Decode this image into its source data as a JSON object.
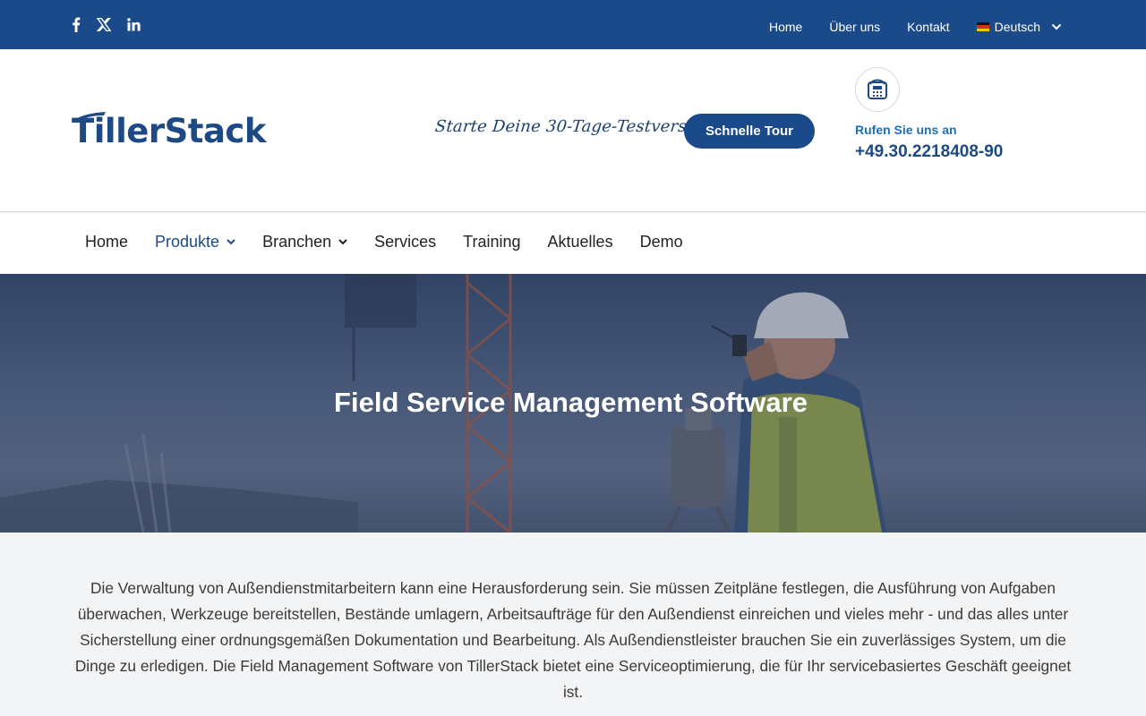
{
  "topbar": {
    "social": [
      "facebook-icon",
      "x-icon",
      "linkedin-icon"
    ],
    "links": [
      "Home",
      "Über uns",
      "Kontakt"
    ],
    "language": "Deutsch"
  },
  "header": {
    "logo_text": "TillerStack",
    "tagline": "Starte Deine 30-Tage-Testversion",
    "tour_button": "Schnelle Tour",
    "call_label": "Rufen Sie uns an",
    "phone": "+49.30.2218408-90"
  },
  "nav": {
    "items": [
      {
        "label": "Home"
      },
      {
        "label": "Produkte"
      },
      {
        "label": "Branchen"
      },
      {
        "label": "Services"
      },
      {
        "label": "Training"
      },
      {
        "label": "Aktuelles"
      },
      {
        "label": "Demo"
      }
    ]
  },
  "hero": {
    "title": "Field Service Management Software"
  },
  "content": {
    "paragraph": "Die Verwaltung von Außendienstmitarbeitern kann eine Herausforderung sein. Sie müssen Zeitpläne festlegen, die Ausführung von Aufgaben überwachen, Werkzeuge bereitstellen, Bestände umlagern, Arbeitsaufträge für den Außendienst einreichen und vieles mehr - und das alles unter Sicherstellung einer ordnungsgemäßen Dokumentation und Bearbeitung. Als Außendienstleister brauchen Sie ein zuverlässiges System, um die Dinge zu erledigen. Die Field Management Software von TillerStack bietet eine Serviceoptimierung, die für Ihr servicebasiertes Geschäft geeignet ist."
  },
  "colors": {
    "brand": "#1a4a8a",
    "accent": "#1d6fb8"
  }
}
